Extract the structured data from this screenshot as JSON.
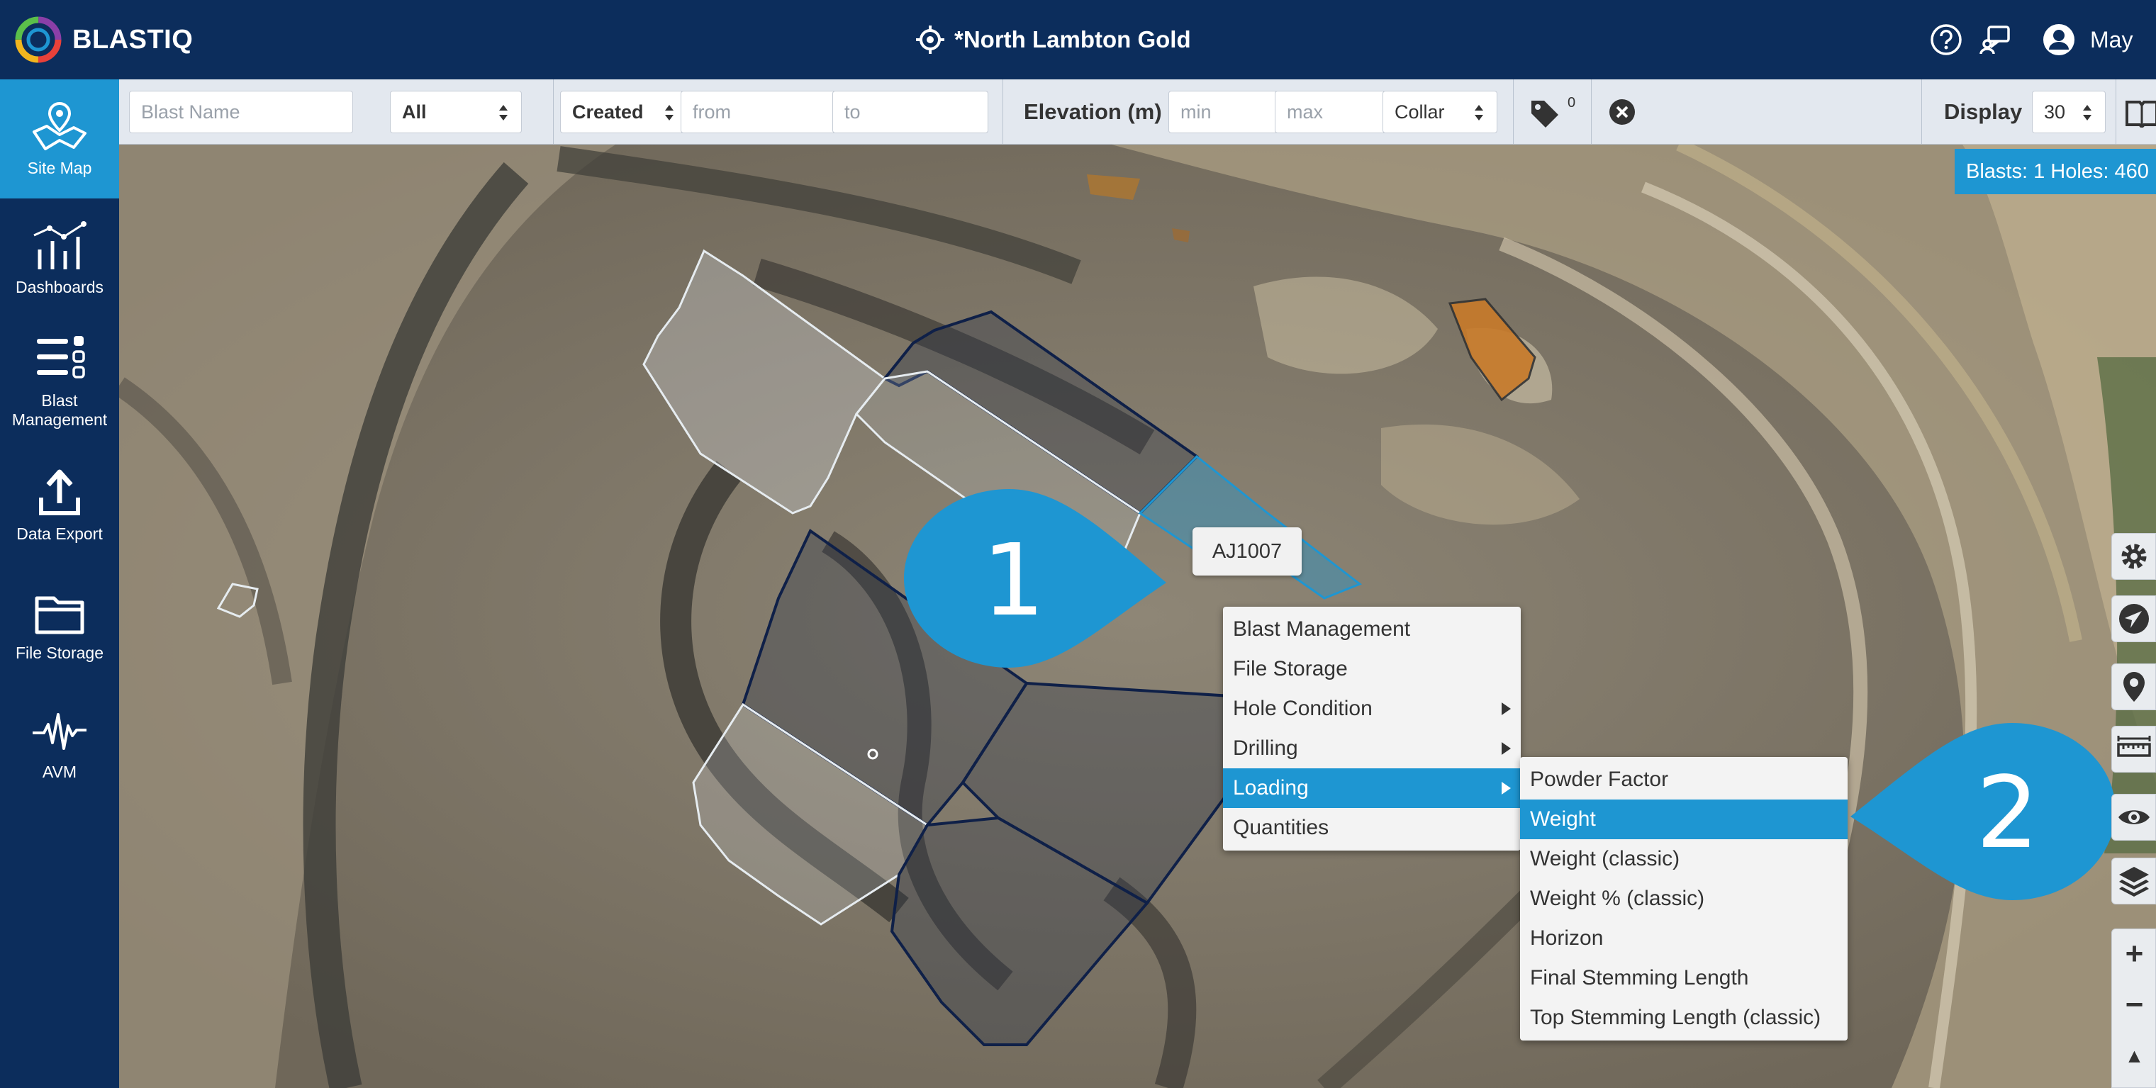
{
  "header": {
    "logo_text": "BLASTIQ",
    "site_name": "*North Lambton Gold",
    "user_name": "May"
  },
  "sidebar": {
    "items": [
      {
        "label": "Site Map",
        "icon": "map-icon",
        "active": true
      },
      {
        "label": "Dashboards",
        "icon": "chart-icon"
      },
      {
        "label": "Blast Management",
        "icon": "list-icon"
      },
      {
        "label": "Data Export",
        "icon": "upload-icon"
      },
      {
        "label": "File Storage",
        "icon": "folder-icon"
      },
      {
        "label": "AVM",
        "icon": "waveform-icon"
      }
    ]
  },
  "filters": {
    "blast_name_placeholder": "Blast Name",
    "type_value": "All",
    "date_field_value": "Created",
    "from_placeholder": "from",
    "to_placeholder": "to",
    "elevation_label": "Elevation (m)",
    "min_placeholder": "min",
    "max_placeholder": "max",
    "elevation_ref_value": "Collar",
    "tag_count": "0",
    "display_label": "Display",
    "display_value": "30"
  },
  "map": {
    "stats_text": "Blasts: 1 Holes: 460",
    "tooltip": "AJ1007"
  },
  "context_menu": {
    "items": [
      {
        "label": "Blast Management"
      },
      {
        "label": "File Storage"
      },
      {
        "label": "Hole Condition",
        "submenu": true
      },
      {
        "label": "Drilling",
        "submenu": true
      },
      {
        "label": "Loading",
        "submenu": true,
        "active": true
      },
      {
        "label": "Quantities"
      }
    ]
  },
  "submenu": {
    "items": [
      {
        "label": "Powder Factor"
      },
      {
        "label": "Weight",
        "active": true
      },
      {
        "label": "Weight (classic)"
      },
      {
        "label": "Weight % (classic)"
      },
      {
        "label": "Horizon"
      },
      {
        "label": "Final Stemming Length"
      },
      {
        "label": "Top Stemming Length (classic)"
      }
    ]
  },
  "callouts": [
    {
      "number": "1"
    },
    {
      "number": "2"
    }
  ],
  "map_controls": [
    "settings-icon",
    "navigate-icon",
    "pin-icon",
    "ruler-icon",
    "eye-icon",
    "layers-icon"
  ],
  "zoom": {
    "plus": "+",
    "minus": "−",
    "north": "▲"
  },
  "colors": {
    "navy": "#0c2d5c",
    "accent_blue": "#1e96d2",
    "highlight_orange": "#c87a2a"
  }
}
